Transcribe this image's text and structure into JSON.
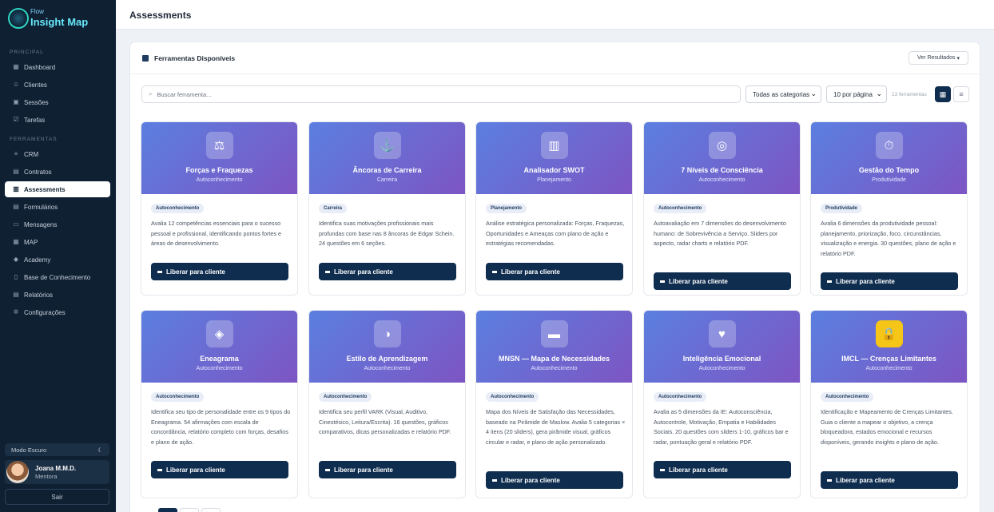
{
  "app": {
    "logo_small": "Flow",
    "logo_main_a": "Insight",
    "logo_main_b": " Map"
  },
  "sidebar": {
    "sections": [
      {
        "label": "PRINCIPAL"
      },
      {
        "label": "FERRAMENTAS"
      }
    ],
    "items": [
      {
        "label": "Dashboard",
        "icon": "grid-icon"
      },
      {
        "label": "Clientes",
        "icon": "users-icon"
      },
      {
        "label": "Sessões",
        "icon": "calendar-icon"
      },
      {
        "label": "Tarefas",
        "icon": "checkbox-icon"
      },
      {
        "label": "CRM",
        "icon": "list-icon"
      },
      {
        "label": "Contratos",
        "icon": "document-icon"
      },
      {
        "label": "Assessments",
        "icon": "clipboard-icon",
        "active": true
      },
      {
        "label": "Formulários",
        "icon": "form-icon"
      },
      {
        "label": "Mensagens",
        "icon": "message-icon"
      },
      {
        "label": "MAP",
        "icon": "map-icon"
      },
      {
        "label": "Academy",
        "icon": "graduation-icon"
      },
      {
        "label": "Base de Conhecimento",
        "icon": "book-icon"
      },
      {
        "label": "Relatórios",
        "icon": "report-icon"
      },
      {
        "label": "Configurações",
        "icon": "gear-icon"
      }
    ],
    "dark_mode_label": "Modo Escuro",
    "user": {
      "name": "Joana M.M.D.",
      "role": "Mentora"
    },
    "logout_label": "Sair"
  },
  "header": {
    "title": "Assessments"
  },
  "panel": {
    "title": "Ferramentas Disponíveis",
    "ver_resultados": "Ver Resultados",
    "search_placeholder": "Buscar ferramenta...",
    "category_select": "Todas as categorias",
    "per_page_select": "10 por página",
    "count": "13 ferramentas"
  },
  "cards": [
    {
      "title": "Forças e Fraquezas",
      "subtitle": "Autoconhecimento",
      "badge": "Autoconhecimento",
      "icon": "scales-icon",
      "description": "Avalia 12 competências essenciais para o sucesso pessoal e profissional, identificando pontos fortes e áreas de desenvolvimento.",
      "button": "Liberar para cliente"
    },
    {
      "title": "Âncoras de Carreira",
      "subtitle": "Carreira",
      "badge": "Carreira",
      "icon": "anchor-icon",
      "description": "Identifica suas motivações profissionais mais profundas com base nas 8 âncoras de Edgar Schein. 24 questões em 6 seções.",
      "button": "Liberar para cliente"
    },
    {
      "title": "Analisador SWOT",
      "subtitle": "Planejamento",
      "badge": "Planejamento",
      "icon": "bar-chart-icon",
      "description": "Análise estratégica personalizada: Forças, Fraquezas, Oportunidades e Ameaças com plano de ação e estratégias recomendadas.",
      "button": "Liberar para cliente"
    },
    {
      "title": "7 Níveis de Consciência",
      "subtitle": "Autoconhecimento",
      "badge": "Autoconhecimento",
      "icon": "target-icon",
      "description": "Autoavaliação em 7 dimensões do desenvolvimento humano: de Sobrevivência a Serviço. Sliders por aspecto, radar charts e relatório PDF.",
      "button": "Liberar para cliente"
    },
    {
      "title": "Gestão do Tempo",
      "subtitle": "Produtividade",
      "badge": "Produtividade",
      "icon": "stopwatch-icon",
      "description": "Avalia 6 dimensões da produtividade pessoal: planejamento, priorização, foco, circunstâncias, visualização e energia. 30 questões, plano de ação e relatório PDF.",
      "button": "Liberar para cliente"
    },
    {
      "title": "Eneagrama",
      "subtitle": "Autoconhecimento",
      "badge": "Autoconhecimento",
      "icon": "diamond-icon",
      "description": "Identifica seu tipo de personalidade entre os 9 tipos do Eneagrama. 54 afirmações com escala de concordância, relatório completo com forças, desafios e plano de ação.",
      "button": "Liberar para cliente"
    },
    {
      "title": "Estilo de Aprendizagem",
      "subtitle": "Autoconhecimento",
      "badge": "Autoconhecimento",
      "icon": "half-circle-icon",
      "description": "Identifica seu perfil VARK (Visual, Auditivo, Cinestésico, Leitura/Escrita). 16 questões, gráficos comparativos, dicas personalizadas e relatório PDF.",
      "button": "Liberar para cliente"
    },
    {
      "title": "MNSN — Mapa de Necessidades",
      "subtitle": "Autoconhecimento",
      "badge": "Autoconhecimento",
      "icon": "briefcase-icon",
      "description": "Mapa dos Níveis de Satisfação das Necessidades, baseado na Pirâmide de Maslow. Avalia 5 categorias × 4 itens (20 sliders), gera pirâmide visual, gráficos circular e radar, e plano de ação personalizado.",
      "button": "Liberar para cliente"
    },
    {
      "title": "Inteligência Emocional",
      "subtitle": "Autoconhecimento",
      "badge": "Autoconhecimento",
      "icon": "heart-icon",
      "description": "Avalia as 5 dimensões da IE: Autoconsciência, Autocontrole, Motivação, Empatia e Habilidades Sociais. 20 questões com sliders 1-10, gráficos bar e radar, pontuação geral e relatório PDF.",
      "button": "Liberar para cliente"
    },
    {
      "title": "IMCL — Crenças Limitantes",
      "subtitle": "Autoconhecimento",
      "badge": "Autoconhecimento",
      "icon": "lock-icon",
      "description": "Identificação e Mapeamento de Crenças Limitantes. Guia o cliente a mapear o objetivo, a crença bloqueadora, estados emocional e recursos disponíveis, gerando insights e plano de ação.",
      "button": "Liberar para cliente"
    }
  ]
}
